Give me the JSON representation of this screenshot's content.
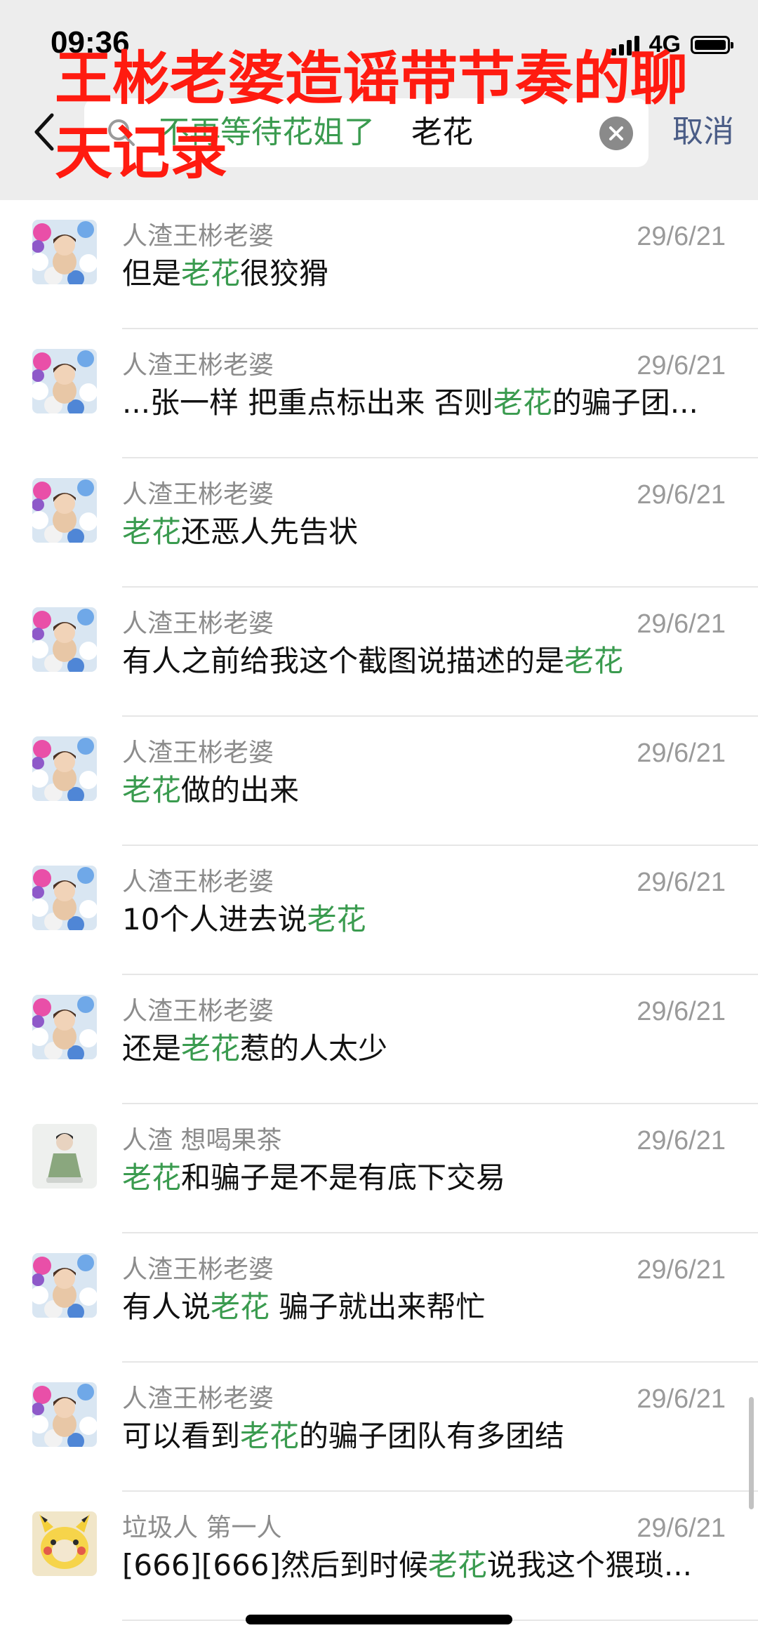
{
  "status_bar": {
    "time": "09:36",
    "network": "4G"
  },
  "overlay_title": "王彬老婆造谣带节奏的聊天记录",
  "search": {
    "chip": "不再等待花姐了",
    "query": "老花",
    "cancel": "取消"
  },
  "colors": {
    "highlight": "#3a9b4f",
    "overlay": "#ff1b10",
    "header_bg": "#ededed"
  },
  "results": [
    {
      "name": "人渣王彬老婆",
      "date": "29/6/21",
      "pre": "但是",
      "hl": "老花",
      "post": "很狡猾",
      "avatar": "balls"
    },
    {
      "name": "人渣王彬老婆",
      "date": "29/6/21",
      "pre": "...张一样 把重点标出来 否则",
      "hl": "老花",
      "post": "的骗子团...",
      "avatar": "balls"
    },
    {
      "name": "人渣王彬老婆",
      "date": "29/6/21",
      "pre": "",
      "hl": "老花",
      "post": "还恶人先告状",
      "avatar": "balls"
    },
    {
      "name": "人渣王彬老婆",
      "date": "29/6/21",
      "pre": "有人之前给我这个截图说描述的是",
      "hl": "老花",
      "post": "",
      "avatar": "balls"
    },
    {
      "name": "人渣王彬老婆",
      "date": "29/6/21",
      "pre": "",
      "hl": "老花",
      "post": "做的出来",
      "avatar": "balls"
    },
    {
      "name": "人渣王彬老婆",
      "date": "29/6/21",
      "pre": "10个人进去说",
      "hl": "老花",
      "post": "",
      "avatar": "balls"
    },
    {
      "name": "人渣王彬老婆",
      "date": "29/6/21",
      "pre": "还是",
      "hl": "老花",
      "post": "惹的人太少",
      "avatar": "balls"
    },
    {
      "name": "人渣 想喝果茶",
      "date": "29/6/21",
      "pre": "",
      "hl": "老花",
      "post": "和骗子是不是有底下交易",
      "avatar": "figure"
    },
    {
      "name": "人渣王彬老婆",
      "date": "29/6/21",
      "pre": "有人说",
      "hl": "老花",
      "post": " 骗子就出来帮忙",
      "avatar": "balls"
    },
    {
      "name": "人渣王彬老婆",
      "date": "29/6/21",
      "pre": "可以看到",
      "hl": "老花",
      "post": "的骗子团队有多团结",
      "avatar": "balls"
    },
    {
      "name": "垃圾人 第一人",
      "date": "29/6/21",
      "pre": "[666][666]然后到时候",
      "hl": "老花",
      "post": "说我这个猥琐...",
      "avatar": "pikachu"
    }
  ]
}
